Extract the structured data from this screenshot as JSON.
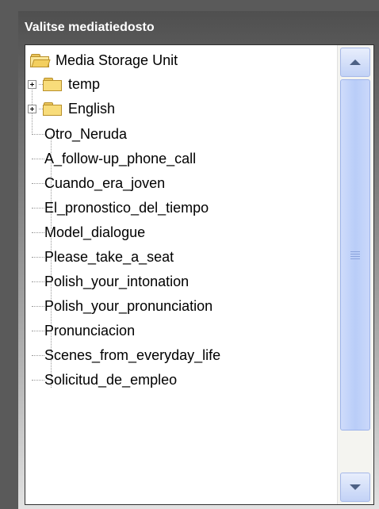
{
  "panel": {
    "title": "Valitse mediatiedosto"
  },
  "tree": {
    "root": {
      "label": "Media Storage Unit",
      "icon": "folder-open-icon"
    },
    "folders": [
      {
        "label": "temp",
        "icon": "folder-icon"
      },
      {
        "label": "English",
        "icon": "folder-icon"
      }
    ],
    "files": [
      "Otro_Neruda",
      "A_follow-up_phone_call",
      "Cuando_era_joven",
      "El_pronostico_del_tiempo",
      "Model_dialogue",
      "Please_take_a_seat",
      "Polish_your_intonation",
      "Polish_your_pronunciation",
      "Pronunciacion",
      "Scenes_from_everyday_life",
      "Solicitud_de_empleo"
    ]
  },
  "scrollbar": {
    "up_icon": "chevron-up-icon",
    "down_icon": "chevron-down-icon",
    "position": 0
  },
  "colors": {
    "header_text": "#ffffff",
    "panel_top": "#4f4f4f",
    "scroll_accent": "#b9cdf8"
  }
}
